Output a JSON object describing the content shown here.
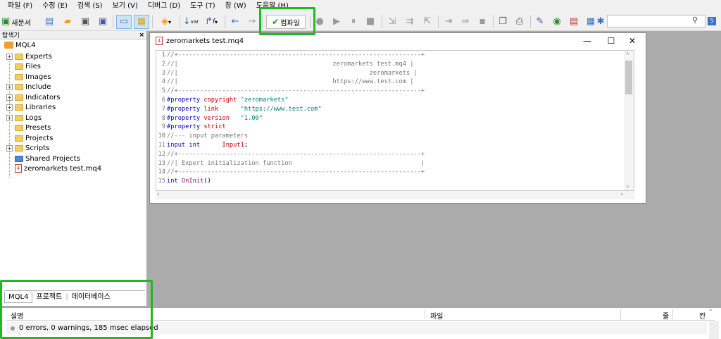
{
  "menu": [
    "파일 (F)",
    "수정 (E)",
    "검색 (S)",
    "보기 (V)",
    "디버그 (D)",
    "도구 (T)",
    "창 (W)",
    "도움말 (H)"
  ],
  "toolbar": {
    "new_label": "새문서",
    "var_label": "var",
    "f_label": "f",
    "compile_label": "컴파일",
    "badge": "5",
    "search_value": ""
  },
  "navigator": {
    "title": "탐색기",
    "close": "×",
    "root": "MQL4",
    "items": [
      {
        "label": "Experts",
        "expandable": true
      },
      {
        "label": "Files",
        "expandable": false
      },
      {
        "label": "Images",
        "expandable": false
      },
      {
        "label": "Include",
        "expandable": true
      },
      {
        "label": "Indicators",
        "expandable": true
      },
      {
        "label": "Libraries",
        "expandable": true
      },
      {
        "label": "Logs",
        "expandable": true
      },
      {
        "label": "Presets",
        "expandable": false
      },
      {
        "label": "Projects",
        "expandable": false
      },
      {
        "label": "Scripts",
        "expandable": true
      },
      {
        "label": "Shared Projects",
        "expandable": false
      },
      {
        "label": "zeromarkets test.mq4",
        "expandable": false
      }
    ],
    "tabs": [
      "MQL4",
      "프로젝트",
      "데이터베이스"
    ]
  },
  "editor": {
    "filename": "zeromarkets test.mq4",
    "controls": {
      "minimize": "—",
      "maximize": "☐",
      "close": "✕"
    },
    "lines": [
      {
        "n": "1",
        "text": "//+------------------------------------------------------------------+"
      },
      {
        "n": "2",
        "text": "//|                                          zeromarkets test.mq4 |"
      },
      {
        "n": "3",
        "text": "//|                                                    zeromarkets |"
      },
      {
        "n": "4",
        "text": "//|                                          https://www.test.com |"
      },
      {
        "n": "5",
        "text": "//+------------------------------------------------------------------+"
      },
      {
        "n": "6",
        "pp": "#property",
        "red": "copyright",
        "str": "\"zeromarkets\""
      },
      {
        "n": "7",
        "pp": "#property",
        "red": "link     ",
        "str": "\"https://www.test.com\""
      },
      {
        "n": "8",
        "pp": "#property",
        "red": "version  ",
        "str": "\"1.00\""
      },
      {
        "n": "9",
        "pp": "#property",
        "red": "strict",
        "str": ""
      },
      {
        "n": "10",
        "text": "//--- input parameters"
      },
      {
        "n": "11",
        "kw": "input int      ",
        "red": "Input1",
        "tail": ";"
      },
      {
        "n": "12",
        "text": "//+------------------------------------------------------------------+"
      },
      {
        "n": "13",
        "text": "//| Expert initialization function                                   |"
      },
      {
        "n": "14",
        "text": "//+------------------------------------------------------------------+"
      },
      {
        "n": "15",
        "kw": "int ",
        "fn": "OnInit",
        "tail": "()"
      }
    ]
  },
  "toolbox": {
    "columns": {
      "desc": "설명",
      "file": "파일",
      "line": "줄",
      "col": "칸"
    },
    "row": "0 errors, 0 warnings, 185 msec elapsed"
  }
}
